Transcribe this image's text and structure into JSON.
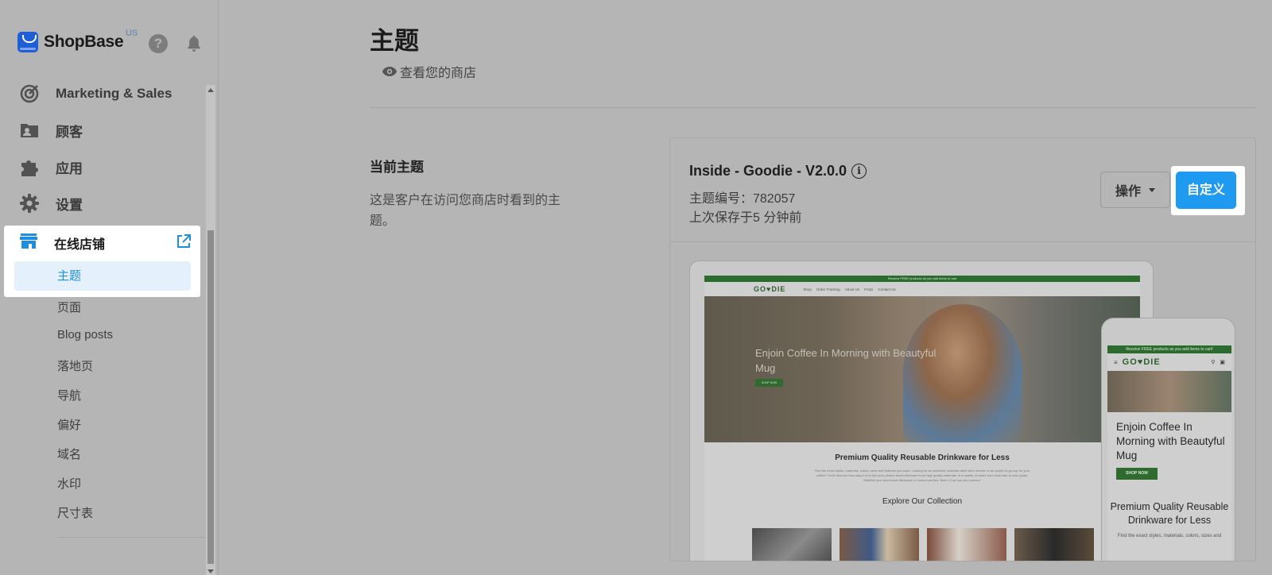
{
  "brand": {
    "name": "ShopBase",
    "region": "US"
  },
  "header_icons": [
    "help-icon",
    "bell-icon"
  ],
  "sidebar": {
    "items": [
      {
        "label": "Marketing & Sales",
        "icon": "target-icon"
      },
      {
        "label": "顾客",
        "icon": "customer-icon"
      },
      {
        "label": "应用",
        "icon": "puzzle-icon"
      },
      {
        "label": "设置",
        "icon": "gear-icon"
      }
    ],
    "online_store": {
      "label": "在线店铺",
      "icon": "store-icon",
      "external_icon": "external-link-icon",
      "active_sub": "主题",
      "sub_items": [
        "页面",
        "Blog posts",
        "落地页",
        "导航",
        "偏好",
        "域名",
        "水印",
        "尺寸表"
      ]
    }
  },
  "main": {
    "title": "主题",
    "view_store": "查看您的商店",
    "section_title": "当前主题",
    "section_desc": "这是客户在访问您商店时看到的主题。",
    "theme": {
      "name": "Inside - Goodie - V2.0.0",
      "id_line": "主题编号：782057",
      "saved_line": "上次保存于5 分钟前"
    },
    "actions_label": "操作",
    "customize_label": "自定义"
  },
  "preview": {
    "desktop": {
      "announcement": "Receive FREE products as you add items to cart",
      "logo": "GO♥DIE",
      "nav": [
        "Shop",
        "Order Tracking",
        "About Us",
        "FAQs",
        "Contact Us"
      ],
      "hero_title": "Enjoin Coffee In Morning with Beautyful Mug",
      "hero_button": "SHOP NOW",
      "heading": "Premium Quality Reusable Drinkware for Less",
      "body": "Find the exact styles, materials, colors, sizes and features you want. Looking for an insulated, stainless steel wine tumbler or an acrylic to-go cup for your coffee? You'll discover how easy it is to find your perfect travel drinkware from high quality materials, in a variety of colors from short tote to wine goals. Whether you need travel drinkware or custom printed, Best 4 Cup has you covered.",
      "collection_heading": "Explore Our Collection"
    },
    "mobile": {
      "announcement": "Receive FREE products as you add items to cart!",
      "logo": "GO♥DIE",
      "hero_title": "Enjoin Coffee In Morning with Beautyful Mug",
      "hero_button": "SHOP NOW",
      "heading": "Premium Quality Reusable Drinkware for Less",
      "body": "Find the exact styles, materials, colors, sizes and"
    }
  },
  "colors": {
    "accent": "#1e9af0",
    "active_text": "#1e8fe0",
    "active_bg": "#e4f1fc",
    "brand_green": "#2c6b2e",
    "overlay": "#b5b5b5"
  }
}
